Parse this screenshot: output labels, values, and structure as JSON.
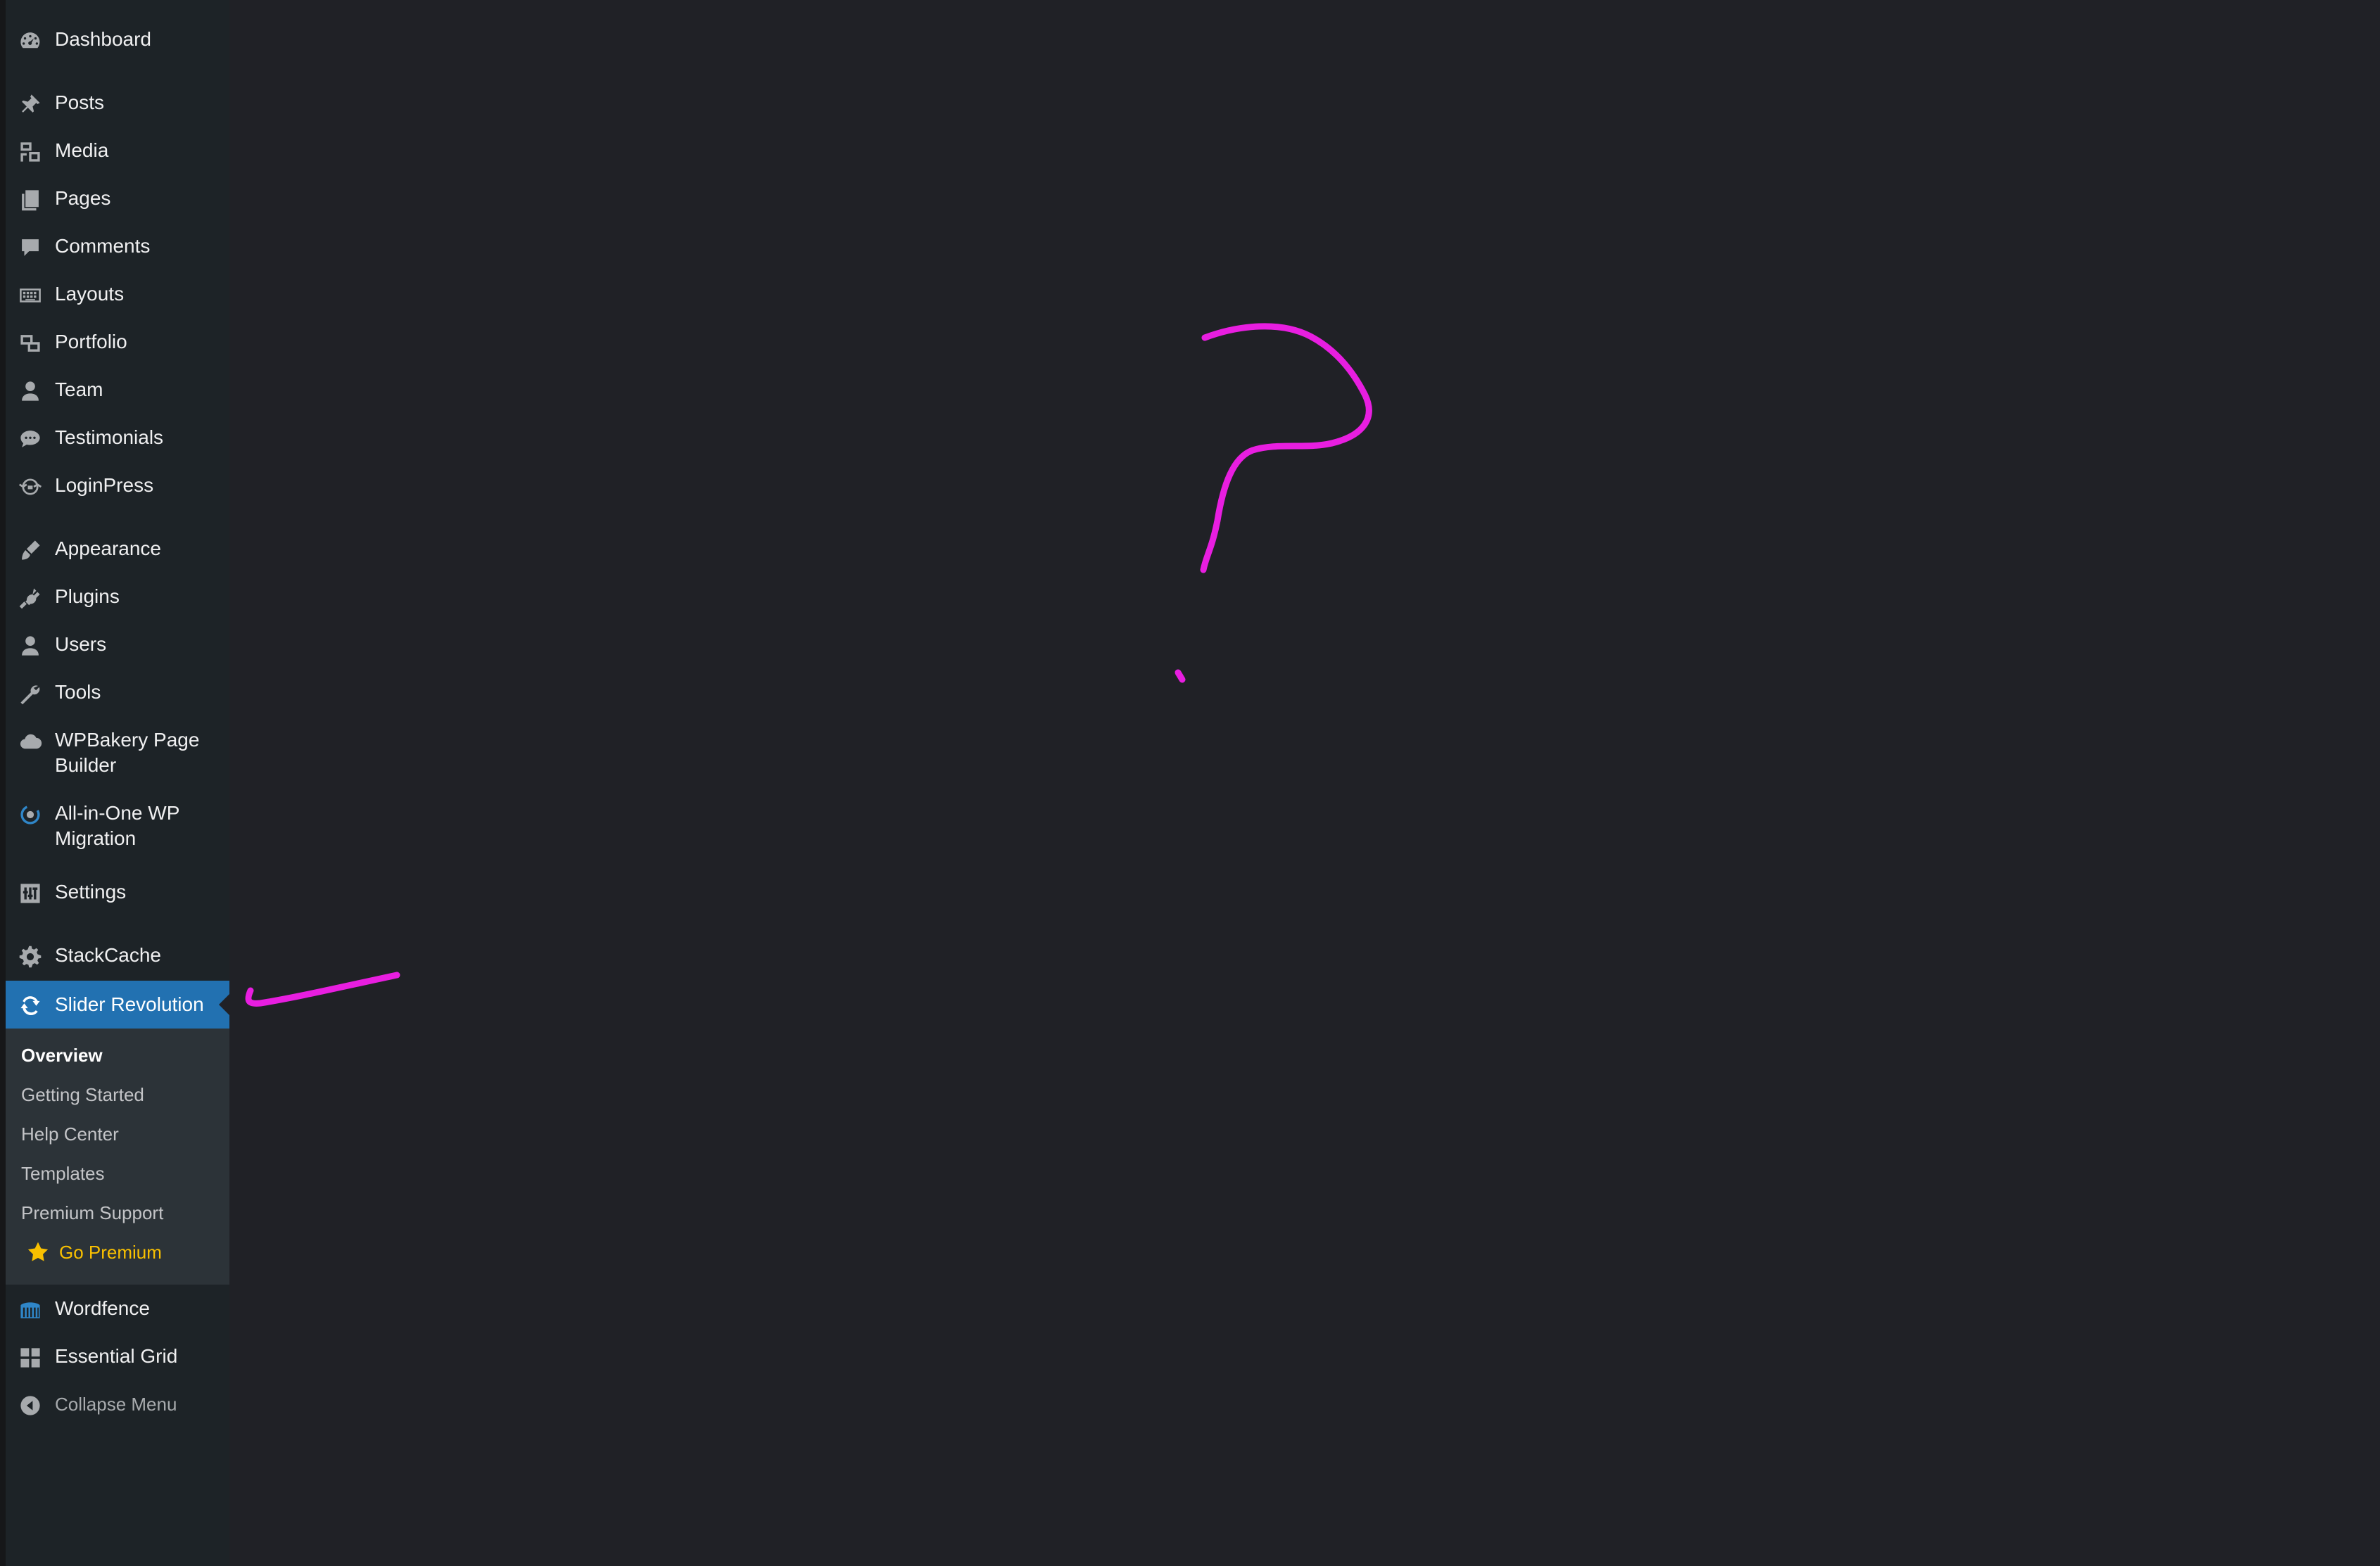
{
  "sidebar": {
    "items": [
      {
        "label": "Dashboard",
        "icon": "dashboard-icon"
      },
      {
        "label": "Posts",
        "icon": "pin-icon"
      },
      {
        "label": "Media",
        "icon": "media-icon"
      },
      {
        "label": "Pages",
        "icon": "pages-icon"
      },
      {
        "label": "Comments",
        "icon": "comment-icon"
      },
      {
        "label": "Layouts",
        "icon": "keyboard-icon"
      },
      {
        "label": "Portfolio",
        "icon": "portfolio-icon"
      },
      {
        "label": "Team",
        "icon": "person-icon"
      },
      {
        "label": "Testimonials",
        "icon": "chat-bubble-icon"
      },
      {
        "label": "LoginPress",
        "icon": "loginpress-icon"
      },
      {
        "label": "Appearance",
        "icon": "paintbrush-icon"
      },
      {
        "label": "Plugins",
        "icon": "plugin-icon"
      },
      {
        "label": "Users",
        "icon": "users-icon"
      },
      {
        "label": "Tools",
        "icon": "wrench-icon"
      },
      {
        "label": "WPBakery Page Builder",
        "label_line1": "WPBakery Page",
        "label_line2": "Builder",
        "icon": "cloud-icon"
      },
      {
        "label": "All-in-One WP Migration",
        "label_line1": "All-in-One WP",
        "label_line2": "Migration",
        "icon": "migration-icon"
      },
      {
        "label": "Settings",
        "icon": "settings-sliders-icon"
      },
      {
        "label": "StackCache",
        "icon": "gear-icon"
      },
      {
        "label": "Slider Revolution",
        "icon": "refresh-icon",
        "active": true
      },
      {
        "label": "Wordfence",
        "icon": "wordfence-icon"
      },
      {
        "label": "Essential Grid",
        "icon": "grid-icon"
      }
    ],
    "submenu": [
      {
        "label": "Overview",
        "current": true
      },
      {
        "label": "Getting Started"
      },
      {
        "label": "Help Center"
      },
      {
        "label": "Templates"
      },
      {
        "label": "Premium Support"
      },
      {
        "label": "Go Premium",
        "icon": "star-icon"
      }
    ],
    "collapse_label": "Collapse Menu"
  },
  "colors": {
    "background": "#202126",
    "sidebar": "#1d2327",
    "active": "#2271b1",
    "submenu": "#2c3338",
    "premium": "#f9c000",
    "annotation": "#e81ee0"
  }
}
